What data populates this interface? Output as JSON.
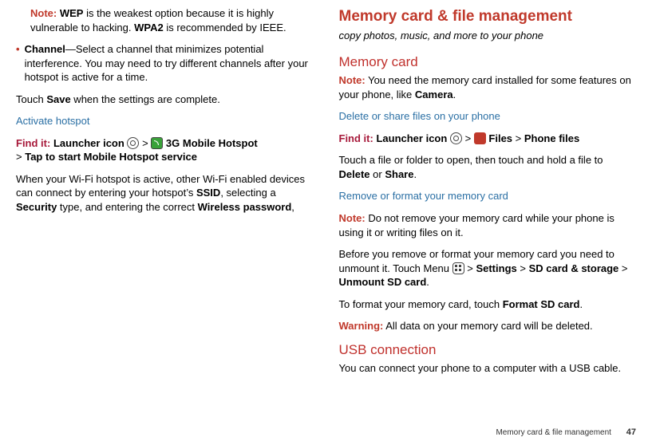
{
  "left": {
    "note_prefix": "Note:",
    "note_body_1": " WEP is the weakest option because it is highly vulnerable to hacking. ",
    "note_bold_1": "WEP",
    "note_body_2": " is recommended by IEEE.",
    "note_bold_2": "WPA2",
    "bullet_mark": "•",
    "channel_bold": "Channel",
    "channel_body": "—Select a channel that minimizes potential interference. You may need to try different channels after your hotspot is active for a time.",
    "touch_save_1": "Touch ",
    "touch_save_bold": "Save",
    "touch_save_2": " when the settings are complete.",
    "activate_heading": "Activate hotspot",
    "findit": "Find it:",
    "findit_path_1": "Launcher icon",
    "findit_path_2": "3G Mobile Hotspot",
    "findit_path_3": "Tap to start Mobile Hotspot service",
    "gt": ">",
    "hotspot_para_1": "When your Wi-Fi hotspot is active, other Wi-Fi enabled devices can connect by entering your hotspot’s ",
    "hotspot_bold_1": "SSID",
    "hotspot_mid_1": ", selecting a ",
    "hotspot_bold_2": "Security",
    "hotspot_mid_2": " type, and entering the correct ",
    "hotspot_bold_3": "Wireless password",
    "hotspot_end": ","
  },
  "right": {
    "h1": "Memory card & file management",
    "tagline": "copy photos, music, and more to your phone",
    "h2_memorycard": "Memory card",
    "note_prefix": "Note:",
    "memcard_note_1": " You need the memory card installed for some features on your phone, like ",
    "memcard_note_bold": "Camera",
    "memcard_note_end": ".",
    "delete_heading": "Delete or share files on your phone",
    "findit": "Find it:",
    "findit_path_1": "Launcher icon",
    "findit_path_2": "Files",
    "findit_path_3": "Phone files",
    "gt": ">",
    "touch_file_1": "Touch a file or folder to open, then touch and hold a file to ",
    "touch_file_bold_1": "Delete",
    "touch_file_mid": " or ",
    "touch_file_bold_2": "Share",
    "touch_file_end": ".",
    "remove_heading": "Remove or format your memory card",
    "remove_note": " Do not remove your memory card while your phone is using it or writing files on it.",
    "unmount_1": "Before you remove or format your memory card you need to unmount it. Touch Menu ",
    "unmount_gt1": " > ",
    "unmount_bold_1": "Settings",
    "unmount_gt2": " > ",
    "unmount_bold_2": "SD card & storage",
    "unmount_gt3": " > ",
    "unmount_bold_3": "Unmount SD card",
    "unmount_end": ".",
    "format_1": "To format your memory card, touch ",
    "format_bold": "Format SD card",
    "format_end": ".",
    "warning_prefix": "Warning:",
    "warning_body": " All data on your memory card will be deleted.",
    "h2_usb": "USB connection",
    "usb_body": "You can connect your phone to a computer with a USB cable."
  },
  "footer": {
    "text": "Memory card & file management",
    "page": "47"
  }
}
